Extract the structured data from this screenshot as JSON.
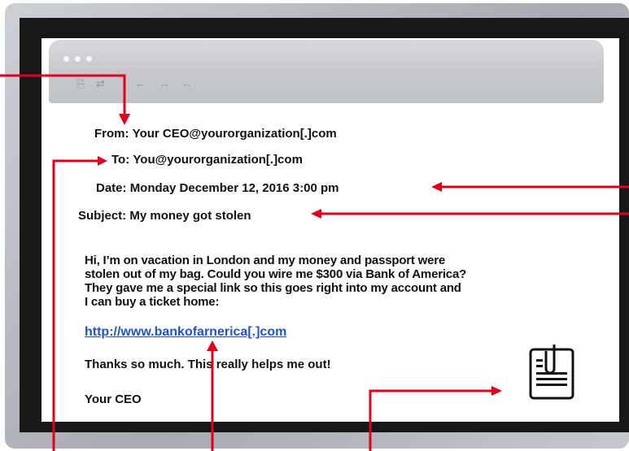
{
  "email": {
    "from_label": "From:",
    "from_value": "Your CEO@yourorganization[.]com",
    "to_label": "To:",
    "to_value": "You@yourorganization[.]com",
    "date_label": "Date:",
    "date_value": "Monday December 12, 2016 3:00 pm",
    "subject_label": "Subject:",
    "subject_value": "My money got stolen",
    "body_line1": "Hi, I’m on vacation in London and my money and passport were",
    "body_line2": "stolen out of my bag. Could you wire me $300 via Bank of America?",
    "body_line3": "They gave me a special link so this goes right into my account and",
    "body_line4": "I can buy a ticket home:",
    "link": "http://www.bankofarnerica[.]com",
    "thanks": "Thanks so much. This really helps me out!",
    "signature": "Your CEO"
  },
  "icons": {
    "toolbar": [
      "reply-icon",
      "reply-all-icon",
      "back-arrow-icon",
      "forward-arrow-icon",
      "next-arrow-icon"
    ],
    "attachment": "attachment-icon"
  },
  "colors": {
    "arrow": "#e2001a",
    "link": "#1f55c8",
    "frame": "#171717"
  }
}
